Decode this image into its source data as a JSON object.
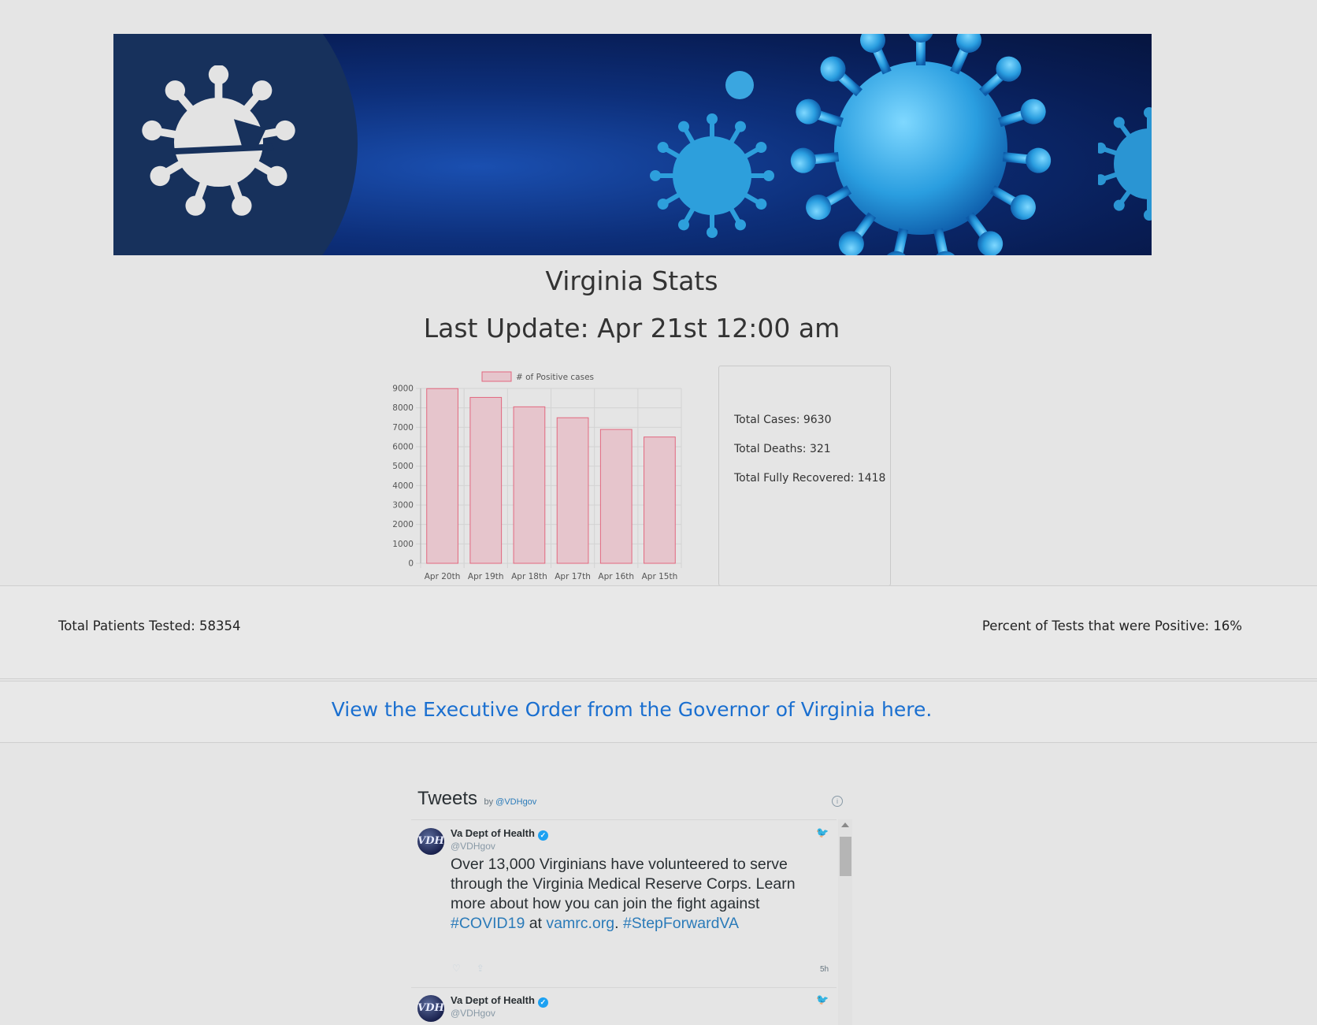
{
  "banner": {
    "image_alt": "COVID-19 virus banner with Virginia logo"
  },
  "header": {
    "title": "Virginia Stats",
    "last_update": "Last Update: Apr 21st 12:00 am"
  },
  "chart_data": {
    "type": "bar",
    "title": "",
    "legend": "# of Positive cases",
    "legend_position": "top",
    "categories": [
      "Apr 20th",
      "Apr 19th",
      "Apr 18th",
      "Apr 17th",
      "Apr 16th",
      "Apr 15th"
    ],
    "series": [
      {
        "name": "# of Positive cases",
        "values": [
          8990,
          8537,
          8053,
          7491,
          6889,
          6500
        ]
      }
    ],
    "ylim": [
      0,
      9000
    ],
    "yticks": [
      0,
      1000,
      2000,
      3000,
      4000,
      5000,
      6000,
      7000,
      8000,
      9000
    ],
    "grid": true,
    "colors": {
      "fill": "#e6c5cc",
      "stroke": "#e2687f",
      "grid": "#d3d3d3"
    }
  },
  "stats": {
    "total_cases": "Total Cases: 9630",
    "total_deaths": "Total Deaths: 321",
    "total_recovered": "Total Fully Recovered: 1418"
  },
  "testing": {
    "total_tested": "Total Patients Tested: 58354",
    "percent_positive": "Percent of Tests that were Positive: 16%"
  },
  "exec_order": {
    "link_text": "View the Executive Order from the Governor of Virginia here."
  },
  "tweets": {
    "title": "Tweets",
    "by": "by",
    "handle_link": "@VDHgov",
    "info_icon": "i",
    "items": [
      {
        "avatar": "VDH",
        "name": "Va Dept of Health",
        "handle": "@VDHgov",
        "text_parts": {
          "p1": "Over 13,000 Virginians have volunteered to serve through the Virginia Medical Reserve Corps.  Learn more about how you can join the fight against ",
          "tag1": "#COVID19",
          "p2": " at ",
          "link": "vamrc.org",
          "p3": ".  ",
          "tag2": "#StepForwardVA"
        },
        "time": "5h"
      },
      {
        "avatar": "VDH",
        "name": "Va Dept of Health",
        "handle": "@VDHgov"
      }
    ]
  },
  "icons": {
    "like": "heart-icon",
    "share": "share-icon",
    "bird": "twitter-bird-icon",
    "verified": "verified-badge-icon"
  }
}
